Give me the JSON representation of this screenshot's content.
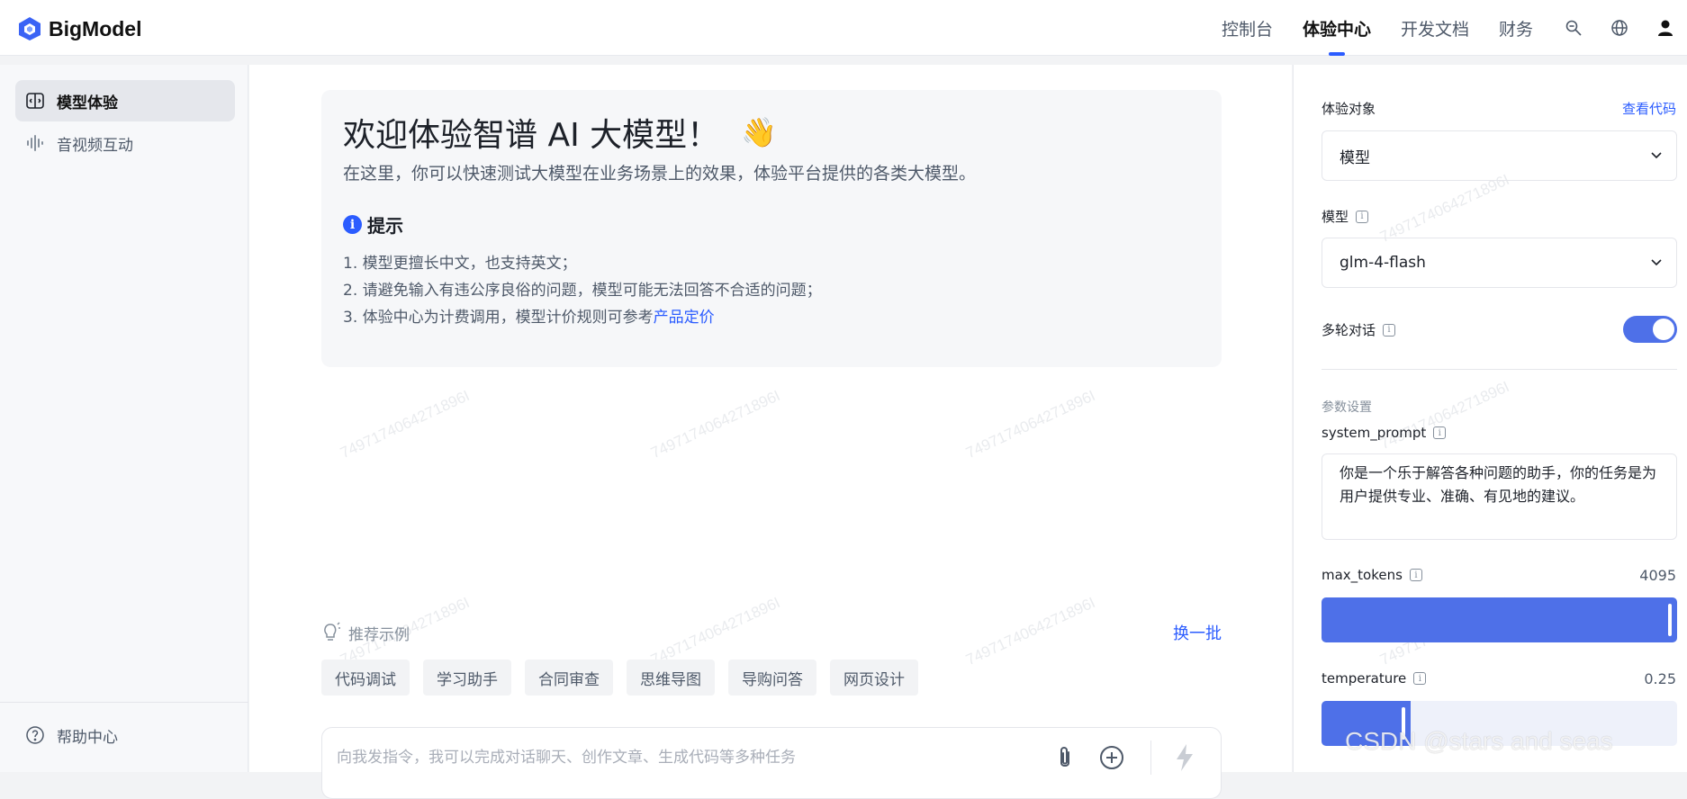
{
  "header": {
    "brand": "BigModel",
    "nav": [
      {
        "label": "控制台",
        "active": false
      },
      {
        "label": "体验中心",
        "active": true
      },
      {
        "label": "开发文档",
        "active": false
      },
      {
        "label": "财务",
        "active": false
      }
    ],
    "icons": [
      "key-search-icon",
      "globe-icon",
      "user-icon"
    ]
  },
  "sidebar": {
    "items": [
      {
        "label": "模型体验",
        "icon": "model-panel-icon",
        "active": true
      },
      {
        "label": "音视频互动",
        "icon": "audio-wave-icon",
        "active": false
      }
    ],
    "bottom_items": [
      {
        "label": "帮助中心",
        "icon": "help-circle-icon"
      }
    ]
  },
  "welcome": {
    "title": "欢迎体验智谱 AI 大模型！",
    "emoji": "👋",
    "subtitle": "在这里，你可以快速测试大模型在业务场景上的效果，体验平台提供的各类大模型。",
    "tip_title": "提示",
    "tips": [
      "1. 模型更擅长中文，也支持英文；",
      "2. 请避免输入有违公序良俗的问题，模型可能无法回答不合适的问题；"
    ],
    "tip3_prefix": "3. 体验中心为计费调用，模型计价规则可参考",
    "tip3_link": "产品定价"
  },
  "watermark": "7497174064271896I",
  "recommend": {
    "label": "推荐示例",
    "refresh": "换一批",
    "chips": [
      "代码调试",
      "学习助手",
      "合同审查",
      "思维导图",
      "导购问答",
      "网页设计"
    ]
  },
  "input": {
    "placeholder": "向我发指令，我可以完成对话聊天、创作文章、生成代码等多种任务"
  },
  "panel": {
    "target_label": "体验对象",
    "view_code": "查看代码",
    "target_value": "模型",
    "model_label": "模型",
    "model_value": "glm-4-flash",
    "multi_turn_label": "多轮对话",
    "multi_turn_on": true,
    "params_label": "参数设置",
    "system_prompt_label": "system_prompt",
    "system_prompt_value": "你是一个乐于解答各种问题的助手，你的任务是为用户提供专业、准确、有见地的建议。",
    "max_tokens_label": "max_tokens",
    "max_tokens_value": "4095",
    "max_tokens_fraction": 1.0,
    "temperature_label": "temperature",
    "temperature_value": "0.25",
    "temperature_fraction": 0.25
  },
  "overlay_watermark": "CSDN @stars and seas",
  "colors": {
    "accent": "#2b5cff",
    "toggle": "#4e70e8"
  }
}
